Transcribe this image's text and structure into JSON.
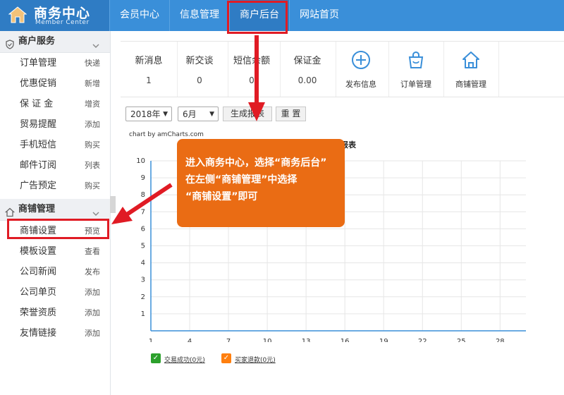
{
  "header": {
    "brand_title": "商务中心",
    "brand_subtitle": "Member Center",
    "nav": [
      {
        "label": "会员中心"
      },
      {
        "label": "信息管理"
      },
      {
        "label": "商户后台",
        "active": true
      },
      {
        "label": "网站首页"
      }
    ],
    "colors": {
      "bar": "#3a8fd9",
      "brand": "#2f7cc4",
      "highlight": "#e01b24"
    }
  },
  "sidebar": {
    "groups": [
      {
        "title": "商户服务",
        "icon": "shield-icon",
        "items": [
          {
            "label": "订单管理",
            "action": "快递"
          },
          {
            "label": "优惠促销",
            "action": "新增"
          },
          {
            "label": "保 证 金",
            "action": "增资"
          },
          {
            "label": "贸易提醒",
            "action": "添加"
          },
          {
            "label": "手机短信",
            "action": "购买"
          },
          {
            "label": "邮件订阅",
            "action": "列表"
          },
          {
            "label": "广告预定",
            "action": "购买"
          }
        ]
      },
      {
        "title": "商铺管理",
        "icon": "home-icon",
        "items": [
          {
            "label": "商铺设置",
            "action": "预览",
            "highlighted": true
          },
          {
            "label": "模板设置",
            "action": "查看"
          },
          {
            "label": "公司新闻",
            "action": "发布"
          },
          {
            "label": "公司单页",
            "action": "添加"
          },
          {
            "label": "荣誉资质",
            "action": "添加"
          },
          {
            "label": "友情链接",
            "action": "添加"
          }
        ]
      }
    ]
  },
  "stats": [
    {
      "label": "新消息",
      "value": "1"
    },
    {
      "label": "新交谈",
      "value": "0"
    },
    {
      "label": "短信余额",
      "value": "0"
    },
    {
      "label": "保证金",
      "value": "0.00"
    }
  ],
  "tools": [
    {
      "label": "发布信息",
      "icon": "plus-circle-icon"
    },
    {
      "label": "订单管理",
      "icon": "shopping-bag-icon"
    },
    {
      "label": "商铺管理",
      "icon": "home-icon"
    }
  ],
  "filters": {
    "year": "2018年",
    "month": "6月",
    "generate_label": "生成报表",
    "reset_label": "重 置"
  },
  "chart_credit": "chart by amCharts.com",
  "chart_data": {
    "type": "line",
    "title": "易报表",
    "xlabel": "",
    "ylabel": "",
    "x_ticks": [
      1,
      4,
      7,
      10,
      13,
      16,
      19,
      22,
      25,
      28
    ],
    "xlim": [
      1,
      30
    ],
    "y_ticks": [
      1,
      2,
      3,
      4,
      5,
      6,
      7,
      8,
      9,
      10
    ],
    "ylim": [
      0,
      10
    ],
    "grid": true,
    "series": [
      {
        "name": "交易成功(0元)",
        "color": "#2ca02c",
        "values": []
      },
      {
        "name": "买家退款(0元)",
        "color": "#ff7f0e",
        "values": []
      }
    ],
    "legend_position": "bottom-left"
  },
  "annotation": {
    "lines": [
      "进入商务中心，选择“商务后台”",
      "在左侧“商铺管理”中选择",
      "“商铺设置”即可"
    ],
    "color": "#ea6c14"
  }
}
